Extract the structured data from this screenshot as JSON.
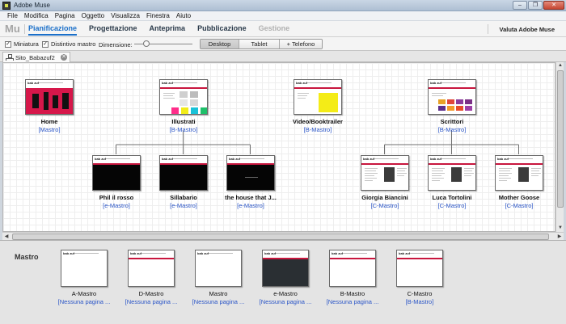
{
  "window": {
    "title": "Adobe Muse"
  },
  "window_buttons": [
    "–",
    "❐",
    "✕"
  ],
  "menu": [
    "File",
    "Modifica",
    "Pagina",
    "Oggetto",
    "Visualizza",
    "Finestra",
    "Aiuto"
  ],
  "app": {
    "logo": "Mu",
    "modes": [
      {
        "label": "Pianificazione",
        "state": "active"
      },
      {
        "label": "Progettazione",
        "state": "normal"
      },
      {
        "label": "Anteprima",
        "state": "normal"
      },
      {
        "label": "Pubblicazione",
        "state": "normal"
      },
      {
        "label": "Gestione",
        "state": "disabled"
      }
    ],
    "rate_label": "Valuta Adobe Muse"
  },
  "options": {
    "thumbnail_label": "Miniatura",
    "thumbnail_checked": true,
    "master_badge_label": "Distintivo mastro",
    "master_badge_checked": true,
    "size_label": "Dimensione:",
    "size_level": 0.15,
    "desktop_label": "Desktop",
    "tablet_label": "Tablet",
    "phone_label": "+ Telefono"
  },
  "document_tab": {
    "label": "Sito_Babazuf2",
    "close": "✕"
  },
  "sitemap": {
    "pages": [
      {
        "name": "Home",
        "master": "[Mastro]",
        "thumb": "home",
        "level": 0
      },
      {
        "name": "Illustrati",
        "master": "[B-Mastro]",
        "thumb": "grid",
        "level": 0
      },
      {
        "name": "Video/Booktrailer",
        "master": "[B-Mastro]",
        "thumb": "yellow",
        "level": 0
      },
      {
        "name": "Scrittori",
        "master": "[B-Mastro]",
        "thumb": "colorgrid",
        "level": 0
      },
      {
        "name": "Phil il rosso",
        "master": "[e-Mastro]",
        "thumb": "black",
        "parent": "Illustrati",
        "level": 1
      },
      {
        "name": "Sillabario",
        "master": "[e-Mastro]",
        "thumb": "black",
        "parent": "Illustrati",
        "level": 1
      },
      {
        "name": "the house that J...",
        "master": "[e-Mastro]",
        "thumb": "black-text",
        "parent": "Illustrati",
        "level": 1
      },
      {
        "name": "Giorgia Biancini",
        "master": "[C-Mastro]",
        "thumb": "photo",
        "parent": "Scrittori",
        "level": 1
      },
      {
        "name": "Luca Tortolini",
        "master": "[C-Mastro]",
        "thumb": "photo",
        "parent": "Scrittori",
        "level": 1
      },
      {
        "name": "Mother Goose",
        "master": "[C-Mastro]",
        "thumb": "photo",
        "parent": "Scrittori",
        "level": 1
      }
    ]
  },
  "masters": {
    "title": "Mastro",
    "items": [
      {
        "name": "A-Mastro",
        "link": "[Nessuna pagina ...",
        "thumb": "white"
      },
      {
        "name": "D-Mastro",
        "link": "[Nessuna pagina ...",
        "thumb": "bar"
      },
      {
        "name": "Mastro",
        "link": "[Nessuna pagina ...",
        "thumb": "white"
      },
      {
        "name": "e-Mastro",
        "link": "[Nessuna pagina ...",
        "thumb": "dark"
      },
      {
        "name": "B-Mastro",
        "link": "[Nessuna pagina ...",
        "thumb": "bar"
      },
      {
        "name": "C-Mastro",
        "link": "[B-Mastro]",
        "thumb": "bar"
      }
    ]
  },
  "thumb_logo": "bab zuf",
  "colors": {
    "accent": "#1a6fc9",
    "brand_red": "#c8163e",
    "link": "#2a55c7"
  }
}
